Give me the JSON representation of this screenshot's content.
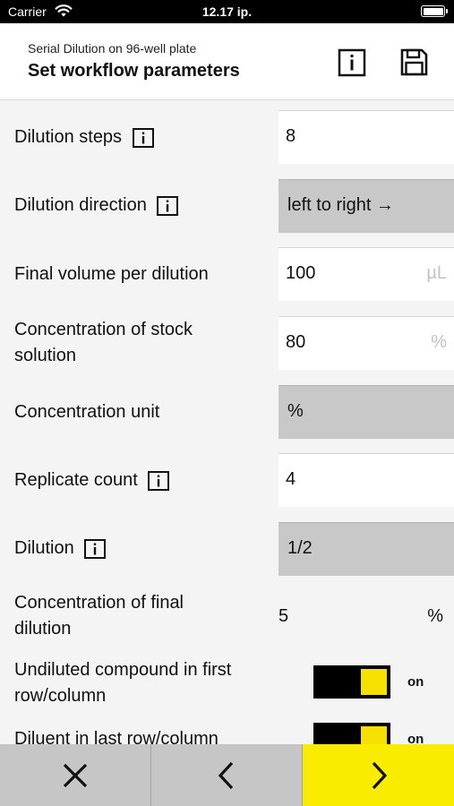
{
  "status_bar": {
    "carrier": "Carrier",
    "time": "12.17 ip."
  },
  "header": {
    "subtitle": "Serial Dilution on 96-well plate",
    "title": "Set workflow parameters",
    "info_icon": "info-icon",
    "save_icon": "save-icon"
  },
  "fields": {
    "dilution_steps": {
      "label": "Dilution steps",
      "value": "8"
    },
    "dilution_direction": {
      "label": "Dilution direction",
      "value": "left to right →"
    },
    "final_volume": {
      "label": "Final volume per dilution",
      "value": "100",
      "unit": "µL"
    },
    "stock_concentration": {
      "label_line1": "Concentration of stock",
      "label_line2": "solution",
      "value": "80",
      "unit": "%"
    },
    "concentration_unit": {
      "label": "Concentration unit",
      "value": "%"
    },
    "replicate_count": {
      "label": "Replicate count",
      "value": "4"
    },
    "dilution": {
      "label": "Dilution",
      "value": "1/2"
    },
    "final_dilution_concentration": {
      "label_line1": "Concentration of final",
      "label_line2": "dilution",
      "value": "5",
      "unit": "%"
    },
    "undiluted_first": {
      "label_line1": "Undiluted compound in first",
      "label_line2": "row/column",
      "state": "on"
    },
    "diluent_last": {
      "label_line1": "Diluent in last row/column",
      "state": "on"
    }
  },
  "footer": {
    "cancel_icon": "close-icon",
    "back_icon": "chevron-left-icon",
    "next_icon": "chevron-right-icon"
  },
  "colors": {
    "accent": "#f9ec00",
    "select_bg": "#c8c8c8",
    "toggle_bg": "#000000"
  }
}
